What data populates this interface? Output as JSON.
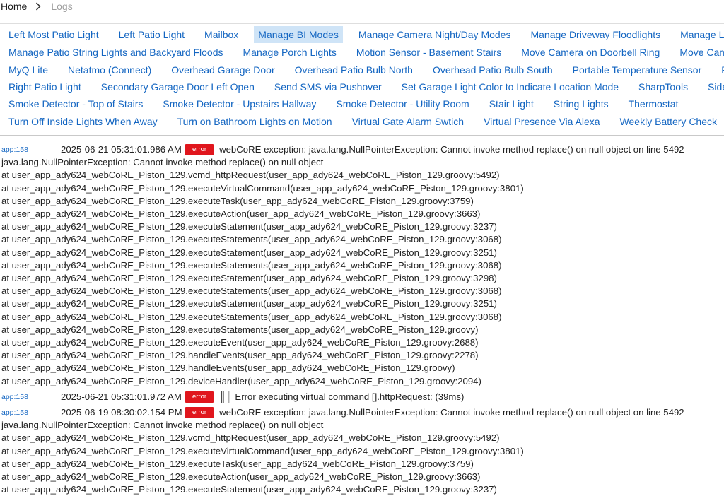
{
  "breadcrumb": {
    "home": "Home",
    "current": "Logs"
  },
  "nav_rows": [
    [
      "Left Most Patio Light",
      "Left Patio Light",
      "Mailbox",
      "Manage BI Modes",
      "Manage Camera Night/Day Modes",
      "Manage Driveway Floodlights",
      "Manage Landscape"
    ],
    [
      "Manage Patio String Lights and Backyard Floods",
      "Manage Porch Lights",
      "Motion Sensor - Basement Stairs",
      "Move Camera on Doorbell Ring",
      "Move Camera on Gate"
    ],
    [
      "MyQ Lite",
      "Netatmo (Connect)",
      "Overhead Garage Door",
      "Overhead Patio Bulb North",
      "Overhead Patio Bulb South",
      "Portable Temperature Sensor",
      "Refrigerator"
    ],
    [
      "Right Patio Light",
      "Secondary Garage Door Left Open",
      "Send SMS via Pushover",
      "Set Garage Light Color to Indicate Location Mode",
      "SharpTools",
      "Side Gate"
    ],
    [
      "Smoke Detector - Top of Stairs",
      "Smoke Detector - Upstairs Hallway",
      "Smoke Detector - Utility Room",
      "Stair Light",
      "String Lights",
      "Thermostat"
    ],
    [
      "Turn Off Inside Lights When Away",
      "Turn on Bathroom Lights on Motion",
      "Virtual Gate Alarm Swtich",
      "Virtual Presence Via Alexa",
      "Weekly Battery Check"
    ]
  ],
  "active_nav": "Manage BI Modes",
  "logs": [
    {
      "app": "app:158",
      "time": "2025-06-21 05:31:01.986 AM",
      "level": "error",
      "message": "webCoRE exception: java.lang.NullPointerException: Cannot invoke method replace() on null object on line 5492",
      "lines": [
        "java.lang.NullPointerException: Cannot invoke method replace() on null object",
        "at user_app_ady624_webCoRE_Piston_129.vcmd_httpRequest(user_app_ady624_webCoRE_Piston_129.groovy:5492)",
        "at user_app_ady624_webCoRE_Piston_129.executeVirtualCommand(user_app_ady624_webCoRE_Piston_129.groovy:3801)",
        "at user_app_ady624_webCoRE_Piston_129.executeTask(user_app_ady624_webCoRE_Piston_129.groovy:3759)",
        "at user_app_ady624_webCoRE_Piston_129.executeAction(user_app_ady624_webCoRE_Piston_129.groovy:3663)",
        "at user_app_ady624_webCoRE_Piston_129.executeStatement(user_app_ady624_webCoRE_Piston_129.groovy:3237)",
        "at user_app_ady624_webCoRE_Piston_129.executeStatements(user_app_ady624_webCoRE_Piston_129.groovy:3068)",
        "at user_app_ady624_webCoRE_Piston_129.executeStatement(user_app_ady624_webCoRE_Piston_129.groovy:3251)",
        "at user_app_ady624_webCoRE_Piston_129.executeStatements(user_app_ady624_webCoRE_Piston_129.groovy:3068)",
        "at user_app_ady624_webCoRE_Piston_129.executeStatement(user_app_ady624_webCoRE_Piston_129.groovy:3298)",
        "at user_app_ady624_webCoRE_Piston_129.executeStatements(user_app_ady624_webCoRE_Piston_129.groovy:3068)",
        "at user_app_ady624_webCoRE_Piston_129.executeStatement(user_app_ady624_webCoRE_Piston_129.groovy:3251)",
        "at user_app_ady624_webCoRE_Piston_129.executeStatements(user_app_ady624_webCoRE_Piston_129.groovy:3068)",
        "at user_app_ady624_webCoRE_Piston_129.executeStatements(user_app_ady624_webCoRE_Piston_129.groovy)",
        "at user_app_ady624_webCoRE_Piston_129.executeEvent(user_app_ady624_webCoRE_Piston_129.groovy:2688)",
        "at user_app_ady624_webCoRE_Piston_129.handleEvents(user_app_ady624_webCoRE_Piston_129.groovy:2278)",
        "at user_app_ady624_webCoRE_Piston_129.handleEvents(user_app_ady624_webCoRE_Piston_129.groovy)",
        "at user_app_ady624_webCoRE_Piston_129.deviceHandler(user_app_ady624_webCoRE_Piston_129.groovy:2094)"
      ]
    },
    {
      "app": "app:158",
      "time": "2025-06-21 05:31:01.972 AM",
      "level": "error",
      "message": "║║ Error executing virtual command [].httpRequest: (39ms)",
      "lines": []
    },
    {
      "app": "app:158",
      "time": "2025-06-19 08:30:02.154 PM",
      "level": "error",
      "message": "webCoRE exception: java.lang.NullPointerException: Cannot invoke method replace() on null object on line 5492",
      "lines": [
        "java.lang.NullPointerException: Cannot invoke method replace() on null object",
        "at user_app_ady624_webCoRE_Piston_129.vcmd_httpRequest(user_app_ady624_webCoRE_Piston_129.groovy:5492)",
        "at user_app_ady624_webCoRE_Piston_129.executeVirtualCommand(user_app_ady624_webCoRE_Piston_129.groovy:3801)",
        "at user_app_ady624_webCoRE_Piston_129.executeTask(user_app_ady624_webCoRE_Piston_129.groovy:3759)",
        "at user_app_ady624_webCoRE_Piston_129.executeAction(user_app_ady624_webCoRE_Piston_129.groovy:3663)",
        "at user_app_ady624_webCoRE_Piston_129.executeStatement(user_app_ady624_webCoRE_Piston_129.groovy:3237)"
      ]
    }
  ],
  "colors": {
    "link": "#1466c2",
    "active_bg": "#cfe4f7",
    "error_badge": "#e0161d"
  },
  "icons": {
    "breadcrumb_separator": "chevron-right-icon"
  }
}
